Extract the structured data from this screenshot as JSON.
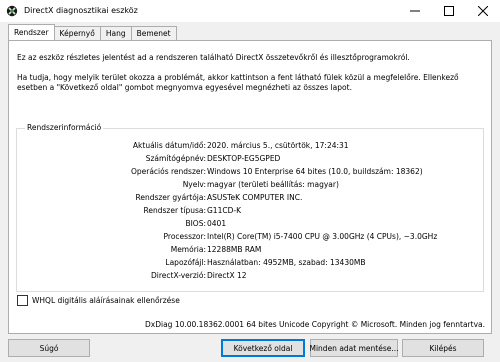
{
  "window": {
    "title": "DirectX diagnosztikai eszköz"
  },
  "tabs": [
    {
      "label": "Rendszer",
      "active": true
    },
    {
      "label": "Képernyő",
      "active": false
    },
    {
      "label": "Hang",
      "active": false
    },
    {
      "label": "Bemenet",
      "active": false
    }
  ],
  "intro": {
    "p1": "Ez az eszköz részletes jelentést ad a rendszeren található DirectX összetevőkről és illesztőprogramokról.",
    "p2": "Ha tudja, hogy melyik terület okozza a problémát, akkor kattintson a fent látható fülek közül a megfelelőre. Ellenkező esetben a \"Következő oldal\" gombot megnyomva egyesével megnézheti az összes lapot."
  },
  "sysinfo": {
    "group_title": "Rendszerinformáció",
    "rows": [
      {
        "label": "Aktuális dátum/idő:",
        "value": "2020. március 5., csütörtök, 17:24:31"
      },
      {
        "label": "Számítógépnév:",
        "value": "DESKTOP-EG5GPED"
      },
      {
        "label": "Operációs rendszer:",
        "value": "Windows 10 Enterprise 64 bites (10.0, buildszám: 18362)"
      },
      {
        "label": "Nyelv:",
        "value": "magyar (területi beállítás: magyar)"
      },
      {
        "label": "Rendszer gyártója:",
        "value": "ASUSTeK COMPUTER INC."
      },
      {
        "label": "Rendszer típusa:",
        "value": "G11CD-K"
      },
      {
        "label": "BIOS:",
        "value": "0401"
      },
      {
        "label": "Processzor:",
        "value": "Intel(R) Core(TM) i5-7400 CPU @ 3.00GHz (4 CPUs), ~3.0GHz"
      },
      {
        "label": "Memória:",
        "value": "12288MB RAM"
      },
      {
        "label": "Lapozófájl:",
        "value": "Használatban: 4952MB, szabad: 13430MB"
      },
      {
        "label": "DirectX-verzió:",
        "value": "DirectX 12"
      }
    ]
  },
  "whql": {
    "label": "WHQL digitális aláírásainak ellenőrzése",
    "checked": false
  },
  "footer": "DxDiag 10.00.18362.0001 64 bites Unicode  Copyright © Microsoft. Minden jog fenntartva.",
  "buttons": {
    "help": "Súgó",
    "next": "Következő oldal",
    "save": "Minden adat mentése...",
    "exit": "Kilépés"
  },
  "colors": {
    "accent": "#0078d7",
    "button_bg": "#e1e1e1"
  }
}
